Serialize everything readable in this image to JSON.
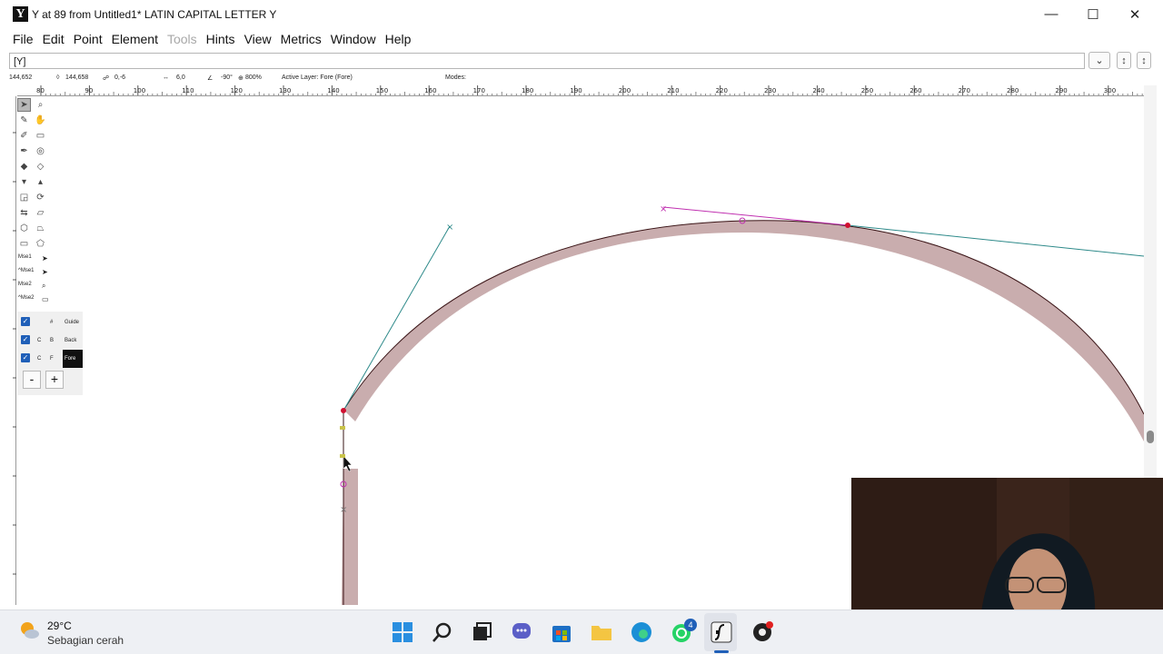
{
  "window": {
    "title": "Y at 89 from Untitled1* LATIN CAPITAL LETTER Y",
    "logo_letter": "Y",
    "minimize_glyph": "—",
    "maximize_glyph": "☐",
    "close_glyph": "✕"
  },
  "menu": {
    "items": [
      "File",
      "Edit",
      "Point",
      "Element",
      "Tools",
      "Hints",
      "View",
      "Metrics",
      "Window",
      "Help"
    ]
  },
  "glyph_field": {
    "value": "[Y]"
  },
  "dropdowns": {
    "chevron": "⌄",
    "arrows": "↕"
  },
  "info": {
    "coords": "144,652",
    "delta": "144,658",
    "dist": "0,-6",
    "length": "6,0",
    "angle": "-90°",
    "zoom": "800%",
    "active_layer": "Active Layer: Fore (Fore)",
    "modes": "Modes:"
  },
  "ruler": {
    "ticks": [
      "80",
      "90",
      "100",
      "110",
      "120",
      "130",
      "140",
      "150",
      "160",
      "170",
      "180",
      "190",
      "200",
      "210",
      "220",
      "230",
      "240",
      "250",
      "260",
      "270",
      "280",
      "290",
      "300"
    ]
  },
  "palette": {
    "mse": [
      "Mse1",
      "^Mse1",
      "Mse2",
      "^Mse2"
    ]
  },
  "layers": {
    "rows": [
      {
        "c": "",
        "b": "#",
        "name": "Guide"
      },
      {
        "c": "C",
        "b": "B",
        "name": "Back"
      },
      {
        "c": "C",
        "b": "F",
        "name": "Fore"
      }
    ],
    "minus": "-",
    "plus": "+"
  },
  "taskbar": {
    "temperature": "29°C",
    "weather": "Sebagian cerah",
    "whatsapp_badge": "4"
  },
  "colors": {
    "stroke_fill": "#c9adae",
    "outline": "#3a1416",
    "control_line": "#2e8a8a",
    "handle_line": "#c030b0",
    "point": "#d01030",
    "accent": "#1f5fb8"
  }
}
